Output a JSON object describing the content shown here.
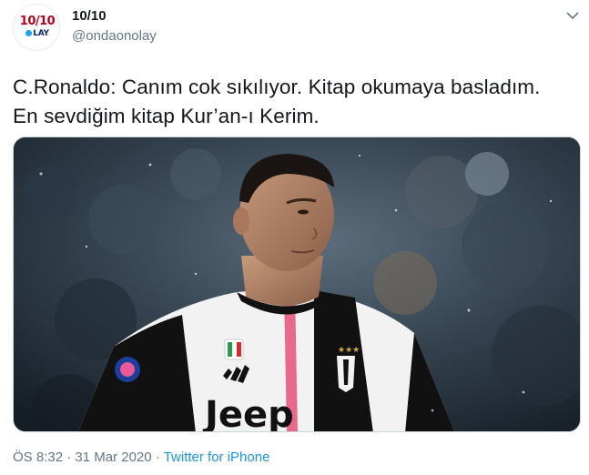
{
  "account": {
    "display_name": "10/10",
    "handle": "@ondaonolay",
    "avatar_logo_top": "10/10",
    "avatar_logo_bottom": "LAY"
  },
  "tweet": {
    "text_line_1": "C.Ronaldo: Canım cok sıkılıyor. Kitap okumaya basladım.",
    "text_line_2": "En sevdiğim kitap Kur’an-ı Kerim."
  },
  "media": {
    "type": "photo",
    "jersey_text": "Jeep"
  },
  "meta": {
    "time": "ÖS 8:32",
    "separator_1": " · ",
    "date": "31 Mar 2020",
    "separator_2": " · ",
    "source": "Twitter for iPhone"
  },
  "icons": {
    "caret": "chevron-down-icon"
  }
}
